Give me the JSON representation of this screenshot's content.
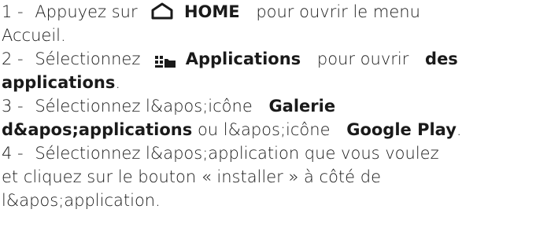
{
  "steps": [
    {
      "prefix": "1 -",
      "text_a": "Appuyez sur",
      "icon": "home-icon",
      "key": "HOME",
      "text_b": "pour ouvrir le menu",
      "text_c": "Accueil."
    },
    {
      "prefix": "2 -",
      "text_a": "Sélectionnez",
      "icon": "apps-icon",
      "key": "Applications",
      "text_b": "pour ouvrir",
      "key2": "des",
      "key3": "applications",
      "text_c": "."
    },
    {
      "prefix": "3 -",
      "text_a": "Sélectionnez l&apos;icône",
      "key": "Galerie",
      "key2": "d&apos;applications",
      "text_b": "ou l&apos;icône",
      "key3": "Google Play",
      "text_c": "."
    },
    {
      "prefix": "4 -",
      "text_a": "Sélectionnez l&apos;application que vous voulez",
      "text_b": "et cliquez sur le bouton « installer » à côté de",
      "text_c": "l&apos;application."
    }
  ]
}
